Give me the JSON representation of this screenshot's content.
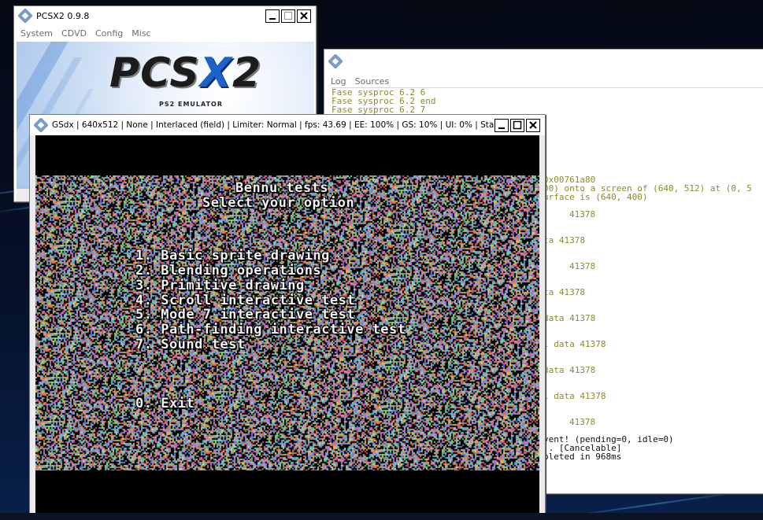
{
  "pcsx2_main": {
    "title": "PCSX2  0.9.8",
    "menu": [
      "System",
      "CDVD",
      "Config",
      "Misc"
    ],
    "logo_main": "PCS",
    "logo_x": "X",
    "logo_tail": "2",
    "logo_sub": "PS2 EMULATOR"
  },
  "console": {
    "menu": [
      "Log",
      "Sources"
    ],
    "lines": [
      {
        "text": "Fase sysproc 6.2 6",
        "color": "olive",
        "indent": 0
      },
      {
        "text": "Fase sysproc 6.2 end",
        "color": "olive",
        "indent": 0
      },
      {
        "text": "Fase sysproc 6.2 7",
        "color": "olive",
        "indent": 0
      },
      {
        "text": "0x00761a80",
        "color": "olive",
        "indent": 269
      },
      {
        "text": "00) onto a screen of (640, 512) at (0, 5",
        "color": "olive",
        "indent": 269
      },
      {
        "text": "urface is (640, 400)",
        "color": "olive",
        "indent": 269
      },
      {
        "text": "41378",
        "color": "olive",
        "indent": 302
      },
      {
        "text": "ta 41378",
        "color": "olive",
        "indent": 269
      },
      {
        "text": "41378",
        "color": "olive",
        "indent": 302
      },
      {
        "text": "ta 41378",
        "color": "olive",
        "indent": 269
      },
      {
        "text": "data 41378",
        "color": "olive",
        "indent": 269
      },
      {
        "text": "l data 41378",
        "color": "olive",
        "indent": 269
      },
      {
        "text": "data 41378",
        "color": "olive",
        "indent": 269
      },
      {
        "text": "l data 41378",
        "color": "olive",
        "indent": 269
      },
      {
        "text": "41378",
        "color": "olive",
        "indent": 302
      },
      {
        "text": "vent! (pending=0, idle=0)",
        "color": "black",
        "indent": 269
      },
      {
        "text": ".. [Cancelable]",
        "color": "black",
        "indent": 269
      },
      {
        "text": "pleted in 968ms",
        "color": "black",
        "indent": 269
      }
    ]
  },
  "gsdx": {
    "title": "GSdx | 640x512 | None | Interlaced (field) | Limiter: Normal | fps:  43.69 | EE: 100% | GS:  10% | UI:   0% | Sta...",
    "heading_1": "Bennu tests",
    "heading_2": "Select your option",
    "options": [
      "1. Basic sprite drawing",
      "2. Blending operations",
      "3. Primitive drawing",
      "4. Scroll interactive test",
      "5. Mode 7 interactive test",
      "6. Path-finding interactive test",
      "7. Sound test"
    ],
    "exit_option": "0. Exit"
  },
  "colors": {
    "log_olive": "#8c8a2c",
    "accent_blue": "#1d62c8",
    "game_text": "#f2f2f2"
  }
}
